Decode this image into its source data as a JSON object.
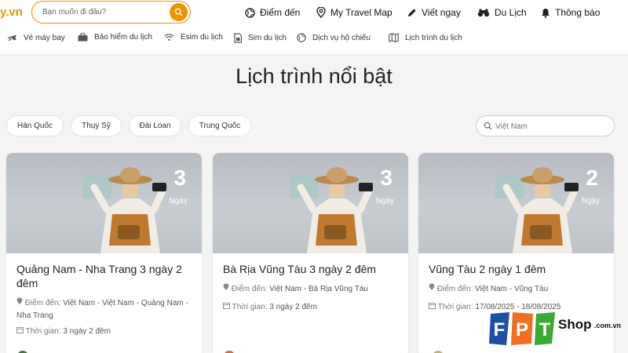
{
  "header": {
    "logo_suffix": "y.vn",
    "search_placeholder": "Bạn muốn đi đâu?",
    "nav": [
      {
        "label": "Điểm đến",
        "icon": "globe-icon"
      },
      {
        "label": "My Travel Map",
        "icon": "map-pin-icon"
      },
      {
        "label": "Viết ngay",
        "icon": "pen-icon"
      },
      {
        "label": "Du Lịch",
        "icon": "binoculars-icon"
      },
      {
        "label": "Thông báo",
        "icon": "bell-icon"
      }
    ]
  },
  "subnav": [
    {
      "label": "Vé máy bay",
      "icon": "plane-icon"
    },
    {
      "label": "Bảo hiểm du lịch",
      "icon": "briefcase-icon"
    },
    {
      "label": "Esim du lịch",
      "icon": "wifi-icon"
    },
    {
      "label": "Sim du lịch",
      "icon": "sim-card-icon"
    },
    {
      "label": "Dịch vụ hộ chiếu",
      "icon": "globe-icon"
    },
    {
      "label": "Lịch trình du lịch",
      "icon": "map-icon"
    }
  ],
  "page_title": "Lịch trình nổi bật",
  "filters": [
    "Hàn Quốc",
    "Thụy Sỹ",
    "Đài Loan",
    "Trung Quốc"
  ],
  "filter_search_placeholder": "Việt Nam",
  "cards": [
    {
      "days": "3",
      "days_unit": "Ngày",
      "title": "Quảng Nam - Nha Trang 3 ngày 2 đêm",
      "dest_label": "Điểm đến:",
      "dest_value": "Việt Nam - Việt Nam - Quảng Nam - Nha Trang",
      "time_label": "Thời gian:",
      "time_value": "3 ngày 2 đêm"
    },
    {
      "days": "3",
      "days_unit": "Ngày",
      "title": "Bà Rịa Vũng Tàu 3 ngày 2 đêm",
      "dest_label": "Điểm đến:",
      "dest_value": "Việt Nam - Bà Rịa Vũng Tàu",
      "time_label": "Thời gian:",
      "time_value": "3 ngày 2 đêm"
    },
    {
      "days": "2",
      "days_unit": "Ngày",
      "title": "Vũng Tàu 2 ngày 1 đêm",
      "dest_label": "Điểm đến:",
      "dest_value": "Việt Nam - Vũng Tàu",
      "time_label": "Thời gian:",
      "time_value": "17/08/2025 - 18/08/2025"
    }
  ],
  "watermark": {
    "brand_letters": [
      "F",
      "P",
      "T"
    ],
    "shop": "Shop",
    "domain": ".com.vn"
  },
  "colors": {
    "accent": "#f39200",
    "fpt_blue": "#1f4ea3",
    "fpt_orange": "#f26f21",
    "fpt_green": "#3aa935"
  }
}
